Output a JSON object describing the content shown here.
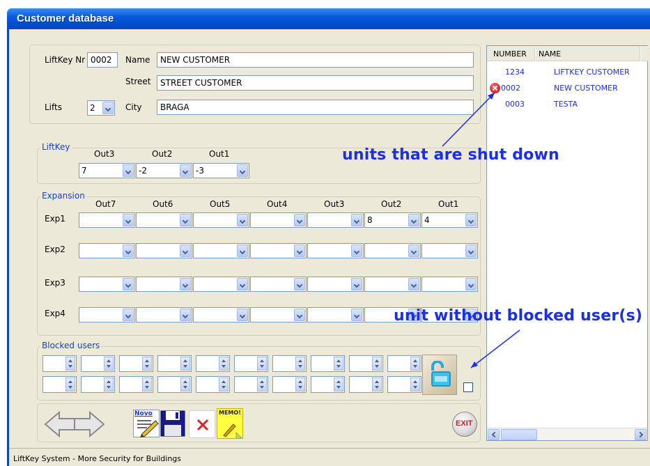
{
  "window": {
    "title": "Customer database"
  },
  "customer": {
    "liftkey_nr_label": "LiftKey Nr",
    "liftkey_nr_value": "0002",
    "name_label": "Name",
    "name_value": "NEW CUSTOMER",
    "street_label": "Street",
    "street_value": "STREET CUSTOMER",
    "lifts_label": "Lifts",
    "lifts_value": "2",
    "city_label": "City",
    "city_value": "BRAGA"
  },
  "liftkey": {
    "title": "LiftKey",
    "outputs": [
      {
        "label": "Out3",
        "value": "7"
      },
      {
        "label": "Out2",
        "value": "-2"
      },
      {
        "label": "Out1",
        "value": "-3"
      }
    ]
  },
  "expansion": {
    "title": "Expansion",
    "columns": [
      "Out7",
      "Out6",
      "Out5",
      "Out4",
      "Out3",
      "Out2",
      "Out1"
    ],
    "rows": [
      {
        "label": "Exp1",
        "values": [
          "",
          "",
          "",
          "",
          "",
          "8",
          "4"
        ]
      },
      {
        "label": "Exp2",
        "values": [
          "",
          "",
          "",
          "",
          "",
          "",
          ""
        ]
      },
      {
        "label": "Exp3",
        "values": [
          "",
          "",
          "",
          "",
          "",
          "",
          ""
        ]
      },
      {
        "label": "Exp4",
        "values": [
          "",
          "",
          "",
          "",
          "",
          "",
          ""
        ]
      }
    ]
  },
  "blocked_users": {
    "title": "Blocked users"
  },
  "customer_list": {
    "columns": [
      "NUMBER",
      "NAME"
    ],
    "rows": [
      {
        "number": "1234",
        "name": "LIFTKEY CUSTOMER",
        "shut_down": false
      },
      {
        "number": "0002",
        "name": "NEW CUSTOMER",
        "shut_down": true
      },
      {
        "number": "0003",
        "name": "TESTA",
        "shut_down": false
      }
    ]
  },
  "toolbar": {
    "new_label": "Novo",
    "memo_label": "MEMO!",
    "exit_label": "EXIT"
  },
  "annotations": {
    "shut_down": "units that are shut down",
    "without_blocked": "unit without blocked user(s)"
  },
  "status": {
    "text": "LiftKey System - More Security for Buildings"
  },
  "colors": {
    "accent": "#1a2ef0",
    "title_bar": "#0a5bdc",
    "list_text": "#1a30d8"
  }
}
